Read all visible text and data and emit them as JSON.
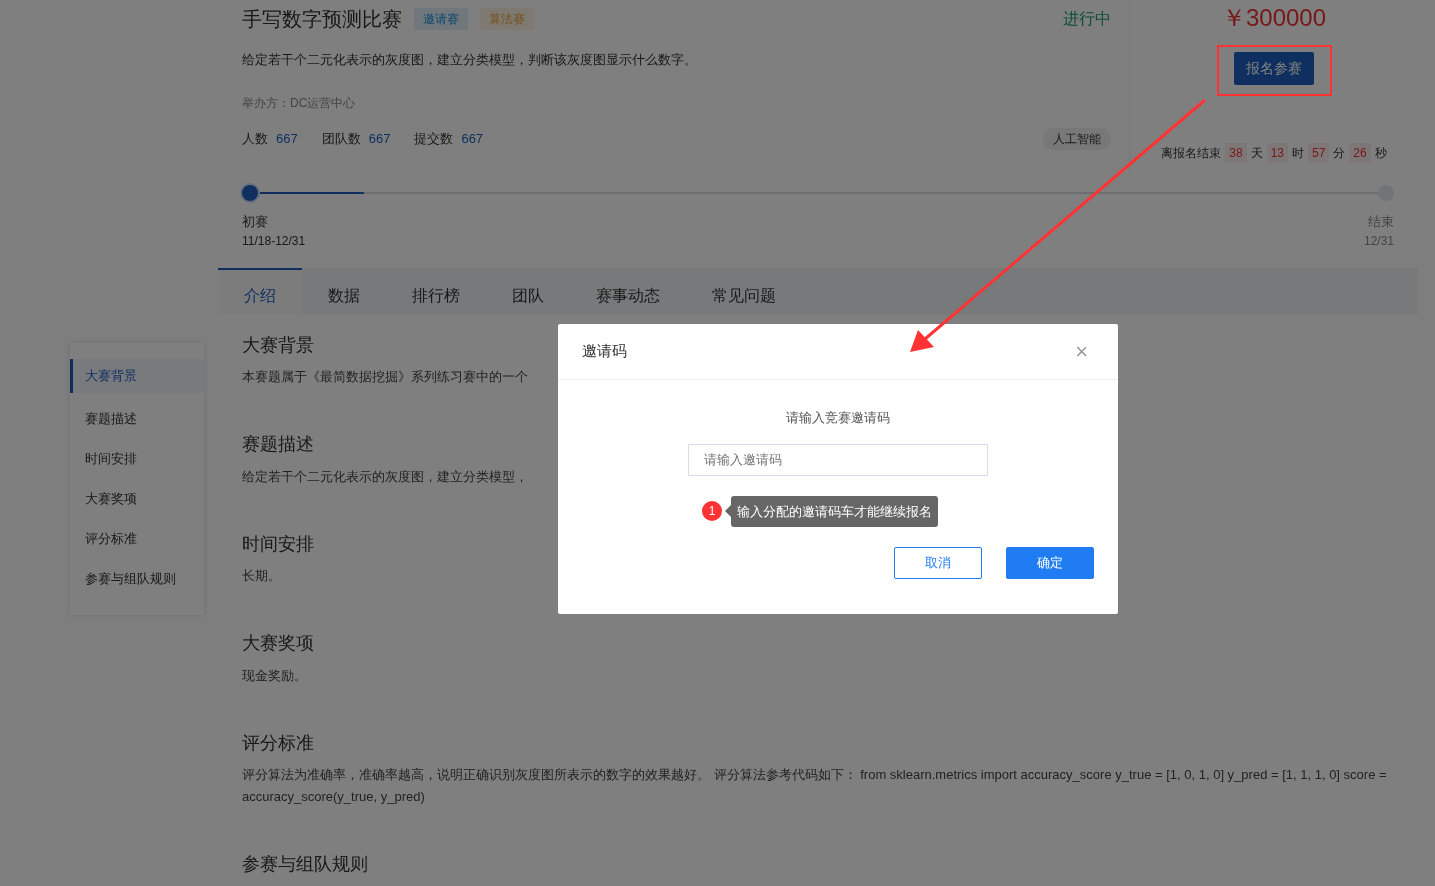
{
  "competition": {
    "title": "手写数字预测比赛",
    "tags": [
      {
        "label": "邀请赛",
        "kind": "invite"
      },
      {
        "label": "算法赛",
        "kind": "algorithm"
      }
    ],
    "status": "进行中",
    "description": "给定若干个二元化表示的灰度图，建立分类模型，判断该灰度图显示什么数字。",
    "organizer": "举办方：DC运营中心",
    "stats": [
      {
        "label": "人数",
        "value": "667"
      },
      {
        "label": "团队数",
        "value": "667"
      },
      {
        "label": "提交数",
        "value": "667"
      }
    ],
    "category": "人工智能",
    "prize": "￥300000",
    "signup_button": "报名参赛",
    "countdown": {
      "label": "离报名结束",
      "parts": [
        {
          "value": "38",
          "unit": "天"
        },
        {
          "value": "13",
          "unit": "时"
        },
        {
          "value": "57",
          "unit": "分"
        },
        {
          "value": "26",
          "unit": "秒"
        }
      ]
    },
    "timeline": {
      "level": 0.1,
      "stages": [
        {
          "name": "初赛",
          "date": "11/18-12/31"
        },
        {
          "name": "结束",
          "date": "12/31"
        }
      ]
    }
  },
  "tabs": [
    {
      "label": "介绍",
      "selected": true
    },
    {
      "label": "数据",
      "selected": false
    },
    {
      "label": "排行榜",
      "selected": false
    },
    {
      "label": "团队",
      "selected": false
    },
    {
      "label": "赛事动态",
      "selected": false
    },
    {
      "label": "常见问题",
      "selected": false
    }
  ],
  "sidebar": {
    "items": [
      {
        "label": "大赛背景",
        "selected": true
      },
      {
        "label": "赛题描述",
        "selected": false
      },
      {
        "label": "时间安排",
        "selected": false
      },
      {
        "label": "大赛奖项",
        "selected": false
      },
      {
        "label": "评分标准",
        "selected": false
      },
      {
        "label": "参赛与组队规则",
        "selected": false
      }
    ]
  },
  "sections": [
    {
      "heading": "大赛背景",
      "body": "本赛题属于《最简数据挖掘》系列练习赛中的一个"
    },
    {
      "heading": "赛题描述",
      "body": "给定若干个二元化表示的灰度图，建立分类模型，"
    },
    {
      "heading": "时间安排",
      "body": "长期。"
    },
    {
      "heading": "大赛奖项",
      "body": "现金奖励。"
    },
    {
      "heading": "评分标准",
      "body": "评分算法为准确率，准确率越高，说明正确识别灰度图所表示的数字的效果越好。 评分算法参考代码如下： from sklearn.metrics import accuracy_score y_true = [1, 0, 1, 0] y_pred = [1, 1, 1, 0] score = accuracy_score(y_true, y_pred)"
    },
    {
      "heading": "参赛与组队规则"
    }
  ],
  "modal": {
    "title": "邀请码",
    "close": "×",
    "prompt": "请输入竞赛邀请码",
    "input": {
      "placeholder": "请输入邀请码"
    },
    "hint": {
      "badge": "1",
      "text": "输入分配的邀请码车才能继续报名"
    },
    "buttons": [
      {
        "label": "取消",
        "kind": "outline"
      },
      {
        "label": "确定",
        "kind": "primary"
      }
    ]
  }
}
